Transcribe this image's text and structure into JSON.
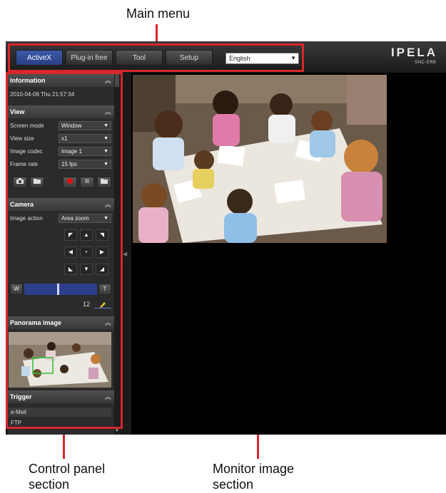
{
  "annotations": {
    "main_menu": "Main menu",
    "control_panel": [
      "Control panel",
      "section"
    ],
    "monitor_image": [
      "Monitor image",
      "section"
    ]
  },
  "topbar": {
    "tabs": [
      {
        "label": "ActiveX",
        "active": true
      },
      {
        "label": "Plug-in free",
        "active": false
      },
      {
        "label": "Tool",
        "active": false
      },
      {
        "label": "Setup",
        "active": false
      }
    ],
    "language": "English",
    "brand": "IPELA",
    "model": "SNC-ER8"
  },
  "panel": {
    "information": {
      "title": "Information",
      "datetime": "2010-04-08 Thu 21:57:34"
    },
    "view": {
      "title": "View",
      "rows": [
        {
          "label": "Screen mode",
          "value": "Window"
        },
        {
          "label": "View size",
          "value": "x1"
        },
        {
          "label": "Image codec",
          "value": "Image 1"
        },
        {
          "label": "Frame rate",
          "value": "15 fps"
        }
      ]
    },
    "camera": {
      "title": "Camera",
      "image_action_label": "Image action",
      "image_action_value": "Area zoom",
      "zoom_wide": "W",
      "zoom_tele": "T",
      "zoom_value": "12"
    },
    "panorama": {
      "title": "Panorama image"
    },
    "trigger": {
      "title": "Trigger",
      "items": [
        "e-Mail",
        "FTP"
      ]
    }
  },
  "icons": {
    "collapse": "double-chevron-up-icon",
    "capture": "camera-capture-icon",
    "folder": "folder-icon",
    "record": "record-icon",
    "stop": "stop-icon"
  },
  "colors": {
    "annotation_red": "#d8262b",
    "active_tab": "#3e5aa8",
    "record_red": "#e01010",
    "zoom_bar": "#2d3f8a"
  }
}
